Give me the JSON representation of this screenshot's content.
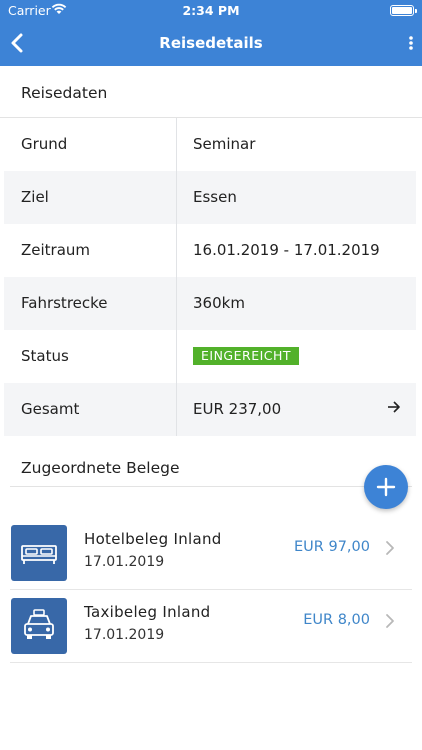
{
  "status_bar": {
    "carrier": "Carrier",
    "time": "2:34 PM"
  },
  "nav": {
    "title": "Reisedetails",
    "back_icon": "chevron-left-icon",
    "more_icon": "more-vertical-icon"
  },
  "reisedaten": {
    "title": "Reisedaten",
    "rows": [
      {
        "key": "Grund",
        "value": "Seminar"
      },
      {
        "key": "Ziel",
        "value": "Essen"
      },
      {
        "key": "Zeitraum",
        "value": "16.01.2019 - 17.01.2019"
      },
      {
        "key": "Fahrstrecke",
        "value": "360km"
      },
      {
        "key": "Status",
        "value": "EINGEREICHT"
      },
      {
        "key": "Gesamt",
        "value": "EUR 237,00"
      }
    ],
    "status_color": "#52b12a"
  },
  "belege": {
    "title": "Zugeordnete Belege",
    "items": [
      {
        "name": "Hotelbeleg Inland",
        "date": "17.01.2019",
        "amount": "EUR 97,00",
        "icon": "bed-icon"
      },
      {
        "name": "Taxibeleg Inland",
        "date": "17.01.2019",
        "amount": "EUR 8,00",
        "icon": "taxi-icon"
      }
    ]
  },
  "colors": {
    "accent": "#3d83d6",
    "amount": "#3f86c9"
  }
}
